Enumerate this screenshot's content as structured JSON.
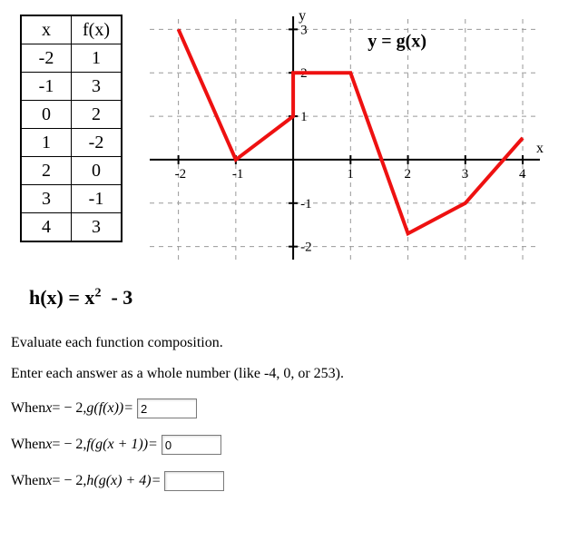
{
  "table": {
    "header_x": "x",
    "header_fx": "f(x)",
    "rows": [
      {
        "x": "-2",
        "fx": "1"
      },
      {
        "x": "-1",
        "fx": "3"
      },
      {
        "x": "0",
        "fx": "2"
      },
      {
        "x": "1",
        "fx": "-2"
      },
      {
        "x": "2",
        "fx": "0"
      },
      {
        "x": "3",
        "fx": "-1"
      },
      {
        "x": "4",
        "fx": "3"
      }
    ]
  },
  "h_equation": "h(x) = x² - 3",
  "instructions_line1": "Evaluate each function composition.",
  "instructions_line2": "Enter each answer as a whole number (like -4, 0, or 253).",
  "questions": [
    {
      "prefix": "When ",
      "var": "x",
      "eq": " = − 2, ",
      "expr": "g(f(x))=",
      "value": "2"
    },
    {
      "prefix": "When ",
      "var": "x",
      "eq": " = − 2, ",
      "expr": "f(g(x + 1))=",
      "value": "0"
    },
    {
      "prefix": "When ",
      "var": "x",
      "eq": " = − 2, ",
      "expr": "h(g(x) + 4)=",
      "value": ""
    }
  ],
  "chart_data": {
    "type": "line",
    "title": "y = g(x)",
    "xlabel": "x",
    "ylabel": "y",
    "xlim": [
      -2.5,
      4.3
    ],
    "ylim": [
      -2.3,
      3.3
    ],
    "x_ticks": [
      -2,
      -1,
      1,
      2,
      3,
      4
    ],
    "y_ticks": [
      -2,
      -1,
      1,
      2,
      3
    ],
    "series": [
      {
        "name": "g(x)",
        "points": [
          {
            "x": -2,
            "y": 3
          },
          {
            "x": -1,
            "y": 0
          },
          {
            "x": 0,
            "y": 1
          },
          {
            "x": 0,
            "y": 2
          },
          {
            "x": 1,
            "y": 2
          },
          {
            "x": 2,
            "y": -1.7
          },
          {
            "x": 3,
            "y": -1
          },
          {
            "x": 4,
            "y": 0.5
          }
        ]
      }
    ]
  }
}
